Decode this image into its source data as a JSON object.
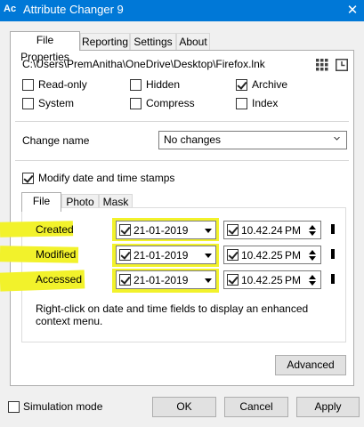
{
  "window": {
    "app_icon_text": "Ac",
    "title": "Attribute Changer 9",
    "close_glyph": "✕"
  },
  "tabs": [
    {
      "label": "File Properties",
      "active": true
    },
    {
      "label": "Reporting",
      "active": false
    },
    {
      "label": "Settings",
      "active": false
    },
    {
      "label": "About",
      "active": false
    }
  ],
  "file_path": "C:\\Users\\PremAnitha\\OneDrive\\Desktop\\Firefox.lnk",
  "attributes": [
    {
      "label": "Read-only",
      "checked": false
    },
    {
      "label": "Hidden",
      "checked": false
    },
    {
      "label": "Archive",
      "checked": true
    },
    {
      "label": "System",
      "checked": false
    },
    {
      "label": "Compress",
      "checked": false
    },
    {
      "label": "Index",
      "checked": false
    }
  ],
  "change_name": {
    "label": "Change name",
    "value": "No changes"
  },
  "modify_dates": {
    "label": "Modify date and time stamps",
    "checked": true
  },
  "sub_tabs": [
    {
      "label": "File",
      "active": true
    },
    {
      "label": "Photo",
      "active": false
    },
    {
      "label": "Mask",
      "active": false
    }
  ],
  "date_rows": [
    {
      "label": "Created",
      "date": "21-01-2019",
      "time": "10.42.24",
      "ampm": "PM",
      "date_checked": true,
      "time_checked": true
    },
    {
      "label": "Modified",
      "date": "21-01-2019",
      "time": "10.42.25",
      "ampm": "PM",
      "date_checked": true,
      "time_checked": true
    },
    {
      "label": "Accessed",
      "date": "21-01-2019",
      "time": "10.42.25",
      "ampm": "PM",
      "date_checked": true,
      "time_checked": true
    }
  ],
  "hint": "Right-click on date and time fields to display an enhanced context menu.",
  "advanced_label": "Advanced",
  "simulation": {
    "label": "Simulation mode",
    "checked": false
  },
  "buttons": {
    "ok": "OK",
    "cancel": "Cancel",
    "apply": "Apply"
  },
  "colors": {
    "titlebar": "#0078d7",
    "highlight": "#f2f22b"
  }
}
